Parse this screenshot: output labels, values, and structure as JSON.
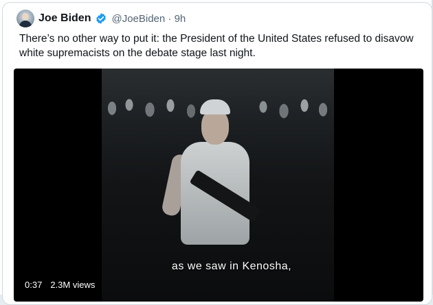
{
  "tweet": {
    "author_name": "Joe Biden",
    "handle_time": "@JoeBiden · 9h",
    "text": "There’s no other way to put it: the President of the United States refused to disavow white supremacists on the debate stage last night."
  },
  "video": {
    "caption": "as we saw in Kenosha,",
    "time": "0:37",
    "views": "2.3M views"
  },
  "icons": {
    "verified": "verified-badge-icon"
  },
  "colors": {
    "verified_blue": "#1d9bf0",
    "text_primary": "#0f1419",
    "text_secondary": "#536471"
  }
}
